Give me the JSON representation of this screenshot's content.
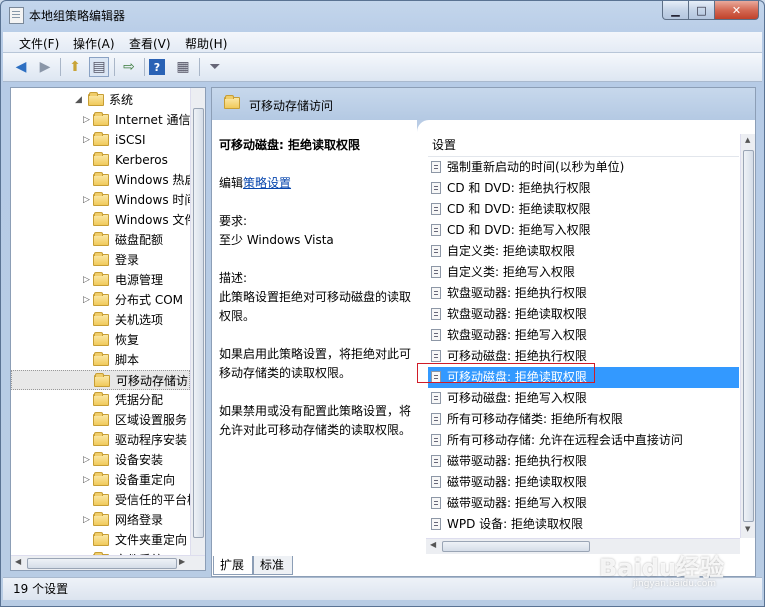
{
  "window": {
    "title": "本地组策略编辑器"
  },
  "menu": [
    "文件(F)",
    "操作(A)",
    "查看(V)",
    "帮助(H)"
  ],
  "tree": [
    {
      "label": "系统",
      "arrow": "◢",
      "indent": 1
    },
    {
      "label": "Internet 通信",
      "arrow": "▷",
      "indent": 2
    },
    {
      "label": "iSCSI",
      "arrow": "▷",
      "indent": 2
    },
    {
      "label": "Kerberos",
      "arrow": "",
      "indent": 2
    },
    {
      "label": "Windows 热启",
      "arrow": "",
      "indent": 2
    },
    {
      "label": "Windows 时间",
      "arrow": "▷",
      "indent": 2
    },
    {
      "label": "Windows 文件",
      "arrow": "",
      "indent": 2
    },
    {
      "label": "磁盘配额",
      "arrow": "",
      "indent": 2
    },
    {
      "label": "登录",
      "arrow": "",
      "indent": 2
    },
    {
      "label": "电源管理",
      "arrow": "▷",
      "indent": 2
    },
    {
      "label": "分布式 COM",
      "arrow": "▷",
      "indent": 2
    },
    {
      "label": "关机选项",
      "arrow": "",
      "indent": 2
    },
    {
      "label": "恢复",
      "arrow": "",
      "indent": 2
    },
    {
      "label": "脚本",
      "arrow": "",
      "indent": 2
    },
    {
      "label": "可移动存储访问",
      "arrow": "",
      "indent": 2,
      "selected": true
    },
    {
      "label": "凭据分配",
      "arrow": "",
      "indent": 2
    },
    {
      "label": "区域设置服务",
      "arrow": "",
      "indent": 2
    },
    {
      "label": "驱动程序安装",
      "arrow": "",
      "indent": 2
    },
    {
      "label": "设备安装",
      "arrow": "▷",
      "indent": 2
    },
    {
      "label": "设备重定向",
      "arrow": "▷",
      "indent": 2
    },
    {
      "label": "受信任的平台模",
      "arrow": "",
      "indent": 2
    },
    {
      "label": "网络登录",
      "arrow": "▷",
      "indent": 2
    },
    {
      "label": "文件夹重定向",
      "arrow": "",
      "indent": 2
    },
    {
      "label": "文件系统",
      "arrow": "▷",
      "indent": 2
    }
  ],
  "header": {
    "title": "可移动存储访问"
  },
  "description": {
    "policy_title": "可移动磁盘: 拒绝读取权限",
    "edit_prefix": "编辑",
    "edit_link": "策略设置",
    "req_label": "要求:",
    "req_value": "至少 Windows Vista",
    "desc_label": "描述:",
    "desc_text": "此策略设置拒绝对可移动磁盘的读取权限。",
    "enable_text": "如果启用此策略设置，将拒绝对此可移动存储类的读取权限。",
    "disable_text": "如果禁用或没有配置此策略设置，将允许对此可移动存储类的读取权限。"
  },
  "list": {
    "column": "设置",
    "items": [
      "强制重新启动的时间(以秒为单位)",
      "CD 和 DVD: 拒绝执行权限",
      "CD 和 DVD: 拒绝读取权限",
      "CD 和 DVD: 拒绝写入权限",
      "自定义类: 拒绝读取权限",
      "自定义类: 拒绝写入权限",
      "软盘驱动器: 拒绝执行权限",
      "软盘驱动器: 拒绝读取权限",
      "软盘驱动器: 拒绝写入权限",
      "可移动磁盘: 拒绝执行权限",
      "可移动磁盘: 拒绝读取权限",
      "可移动磁盘: 拒绝写入权限",
      "所有可移动存储类: 拒绝所有权限",
      "所有可移动存储: 允许在远程会话中直接访问",
      "磁带驱动器: 拒绝执行权限",
      "磁带驱动器: 拒绝读取权限",
      "磁带驱动器: 拒绝写入权限",
      "WPD 设备: 拒绝读取权限"
    ],
    "selected_index": 10
  },
  "tabs": [
    "扩展",
    "标准"
  ],
  "status": "19 个设置",
  "watermark": {
    "main": "Baidu经验",
    "sub": "jingyan.baidu.com"
  }
}
